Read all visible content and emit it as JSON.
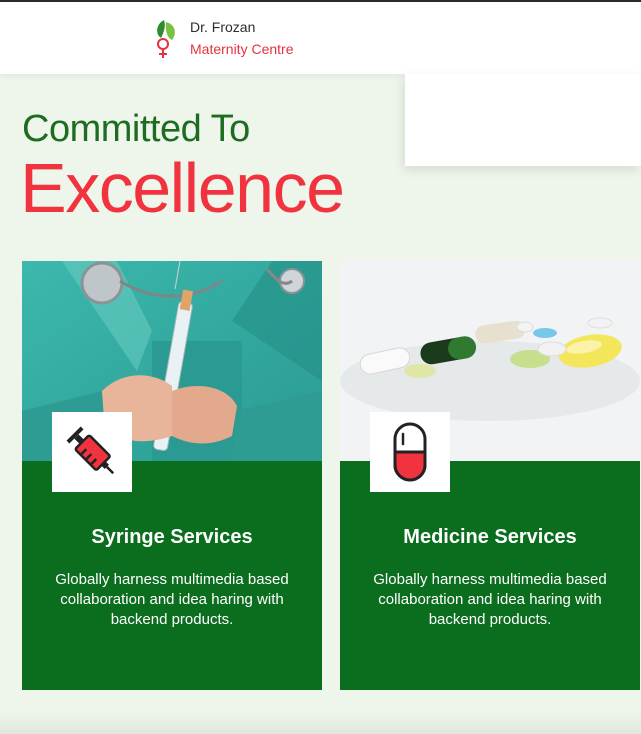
{
  "brand": {
    "line1": "Dr. Frozan",
    "line2": "Maternity Centre",
    "logo_icon": "leaf-female-symbol-icon"
  },
  "hero": {
    "heading_top": "Committed To",
    "heading_main": "Excellence"
  },
  "services": [
    {
      "title": "Syringe Services",
      "description": "Globally harness multimedia based collaboration and idea haring with backend products.",
      "icon": "syringe-icon",
      "photo": "doctor-holding-syringe-photo"
    },
    {
      "title": "Medicine Services",
      "description": "Globally harness multimedia based collaboration and idea haring with backend products.",
      "icon": "capsule-icon",
      "photo": "assorted-pills-photo"
    }
  ],
  "colors": {
    "primary_green": "#0b6d1e",
    "accent_red": "#f0333f",
    "heading_green": "#1e6c22",
    "background": "#eef5ea"
  }
}
